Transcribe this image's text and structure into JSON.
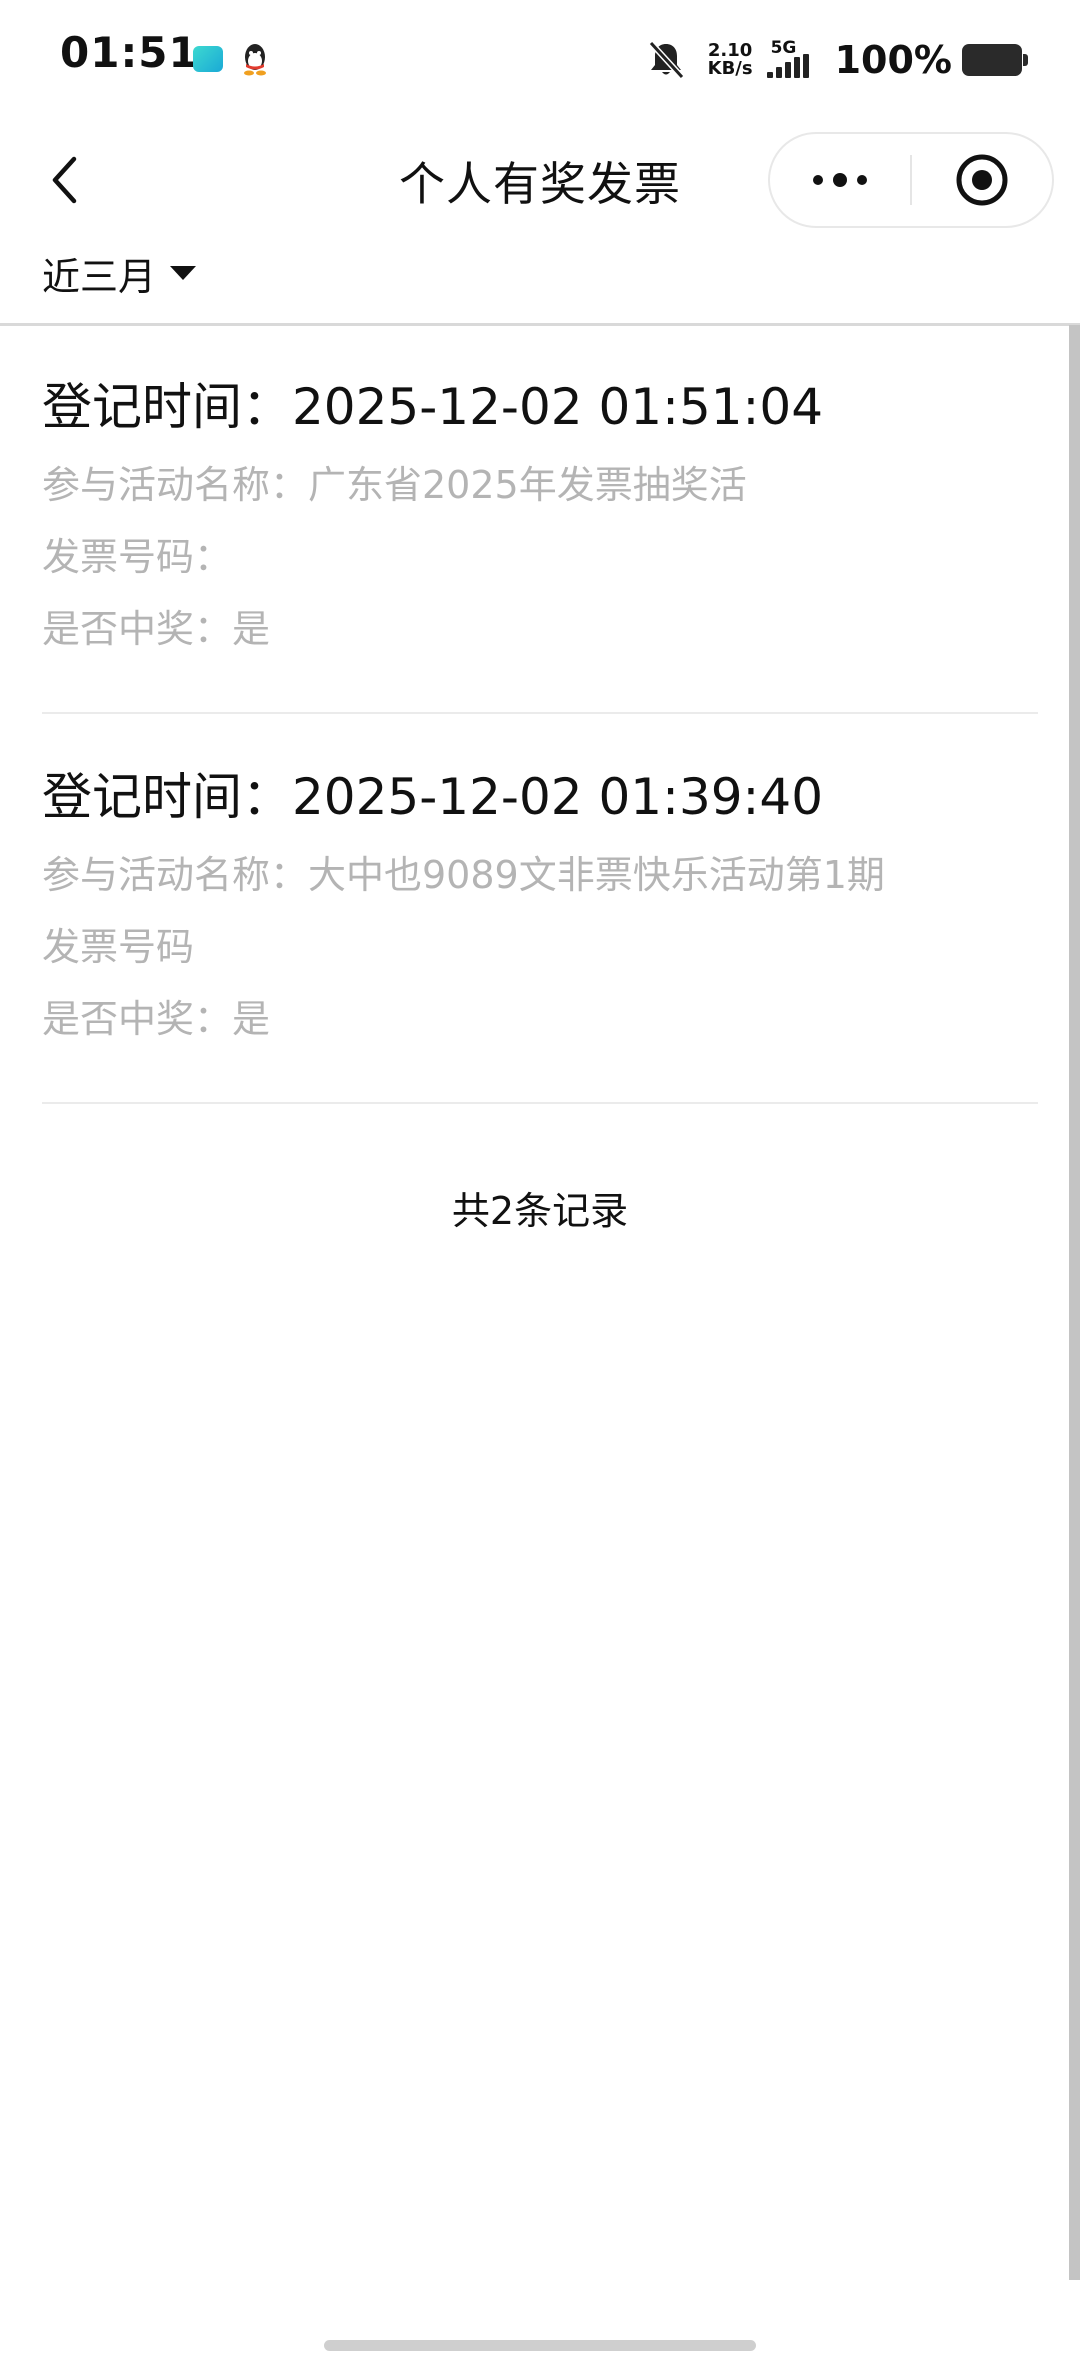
{
  "status_bar": {
    "time": "01:51",
    "net_speed_value": "2.10",
    "net_speed_unit": "KB/s",
    "network_type": "5G",
    "battery": "100%"
  },
  "nav": {
    "title": "个人有奖发票"
  },
  "filter": {
    "label": "近三月"
  },
  "records": [
    {
      "time": "登记时间：2025-12-02 01:51:04",
      "activity": "参与活动名称：广东省2025年发票抽奖活",
      "invoice_no": "发票号码：",
      "won": "是否中奖：是"
    },
    {
      "time": "登记时间：2025-12-02 01:39:40",
      "activity": "参与活动名称：大中也9089文非票快乐活动第1期",
      "invoice_no": "发票号码",
      "won": "是否中奖：是"
    }
  ],
  "footer": {
    "total": "共2条记录"
  },
  "colors": {
    "primary_text": "#111111",
    "secondary_text": "#b4b4b4",
    "divider": "#ebebeb"
  }
}
